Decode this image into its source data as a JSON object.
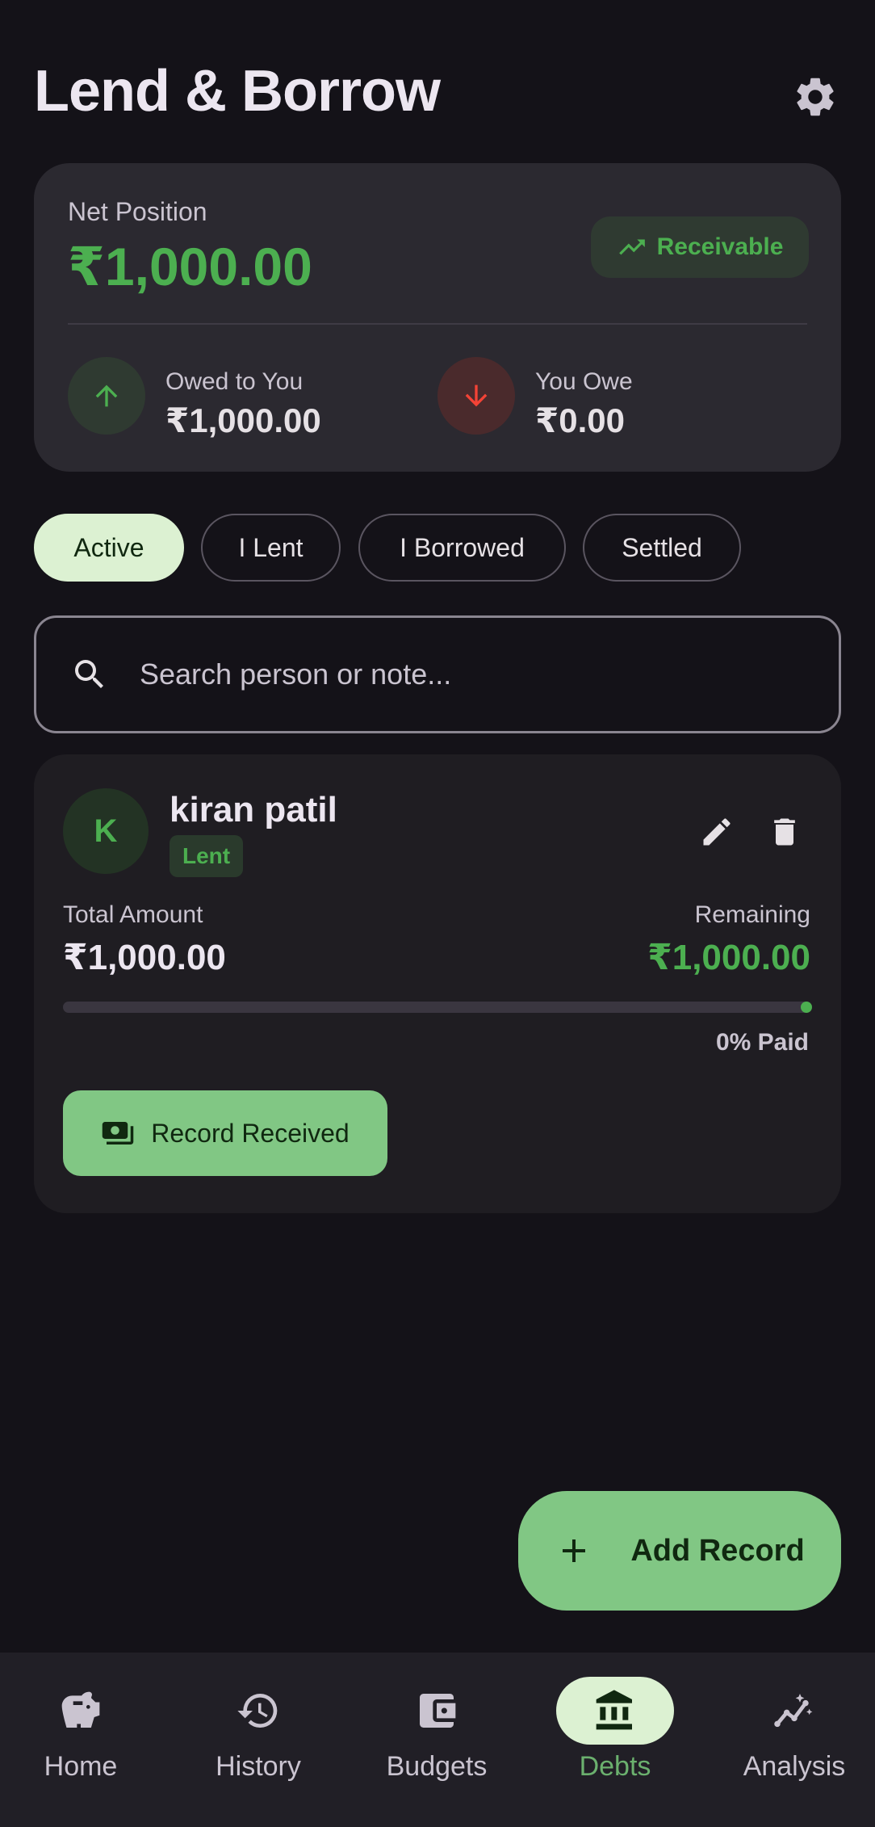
{
  "header": {
    "title": "Lend & Borrow",
    "settings_icon": "gear-icon"
  },
  "summary": {
    "net_label": "Net Position",
    "net_value": "₹1,000.00",
    "badge": "Receivable",
    "owed_to_you_label": "Owed to You",
    "owed_to_you_value": "₹1,000.00",
    "you_owe_label": "You Owe",
    "you_owe_value": "₹0.00"
  },
  "filters": [
    {
      "label": "Active",
      "selected": true
    },
    {
      "label": "I Lent",
      "selected": false
    },
    {
      "label": "I Borrowed",
      "selected": false
    },
    {
      "label": "Settled",
      "selected": false
    }
  ],
  "search": {
    "placeholder": "Search person or note...",
    "value": ""
  },
  "debts": [
    {
      "initial": "K",
      "name": "kiran patil",
      "type": "Lent",
      "total_label": "Total Amount",
      "total_value": "₹1,000.00",
      "remaining_label": "Remaining",
      "remaining_value": "₹1,000.00",
      "paid_fraction": 0,
      "paid_text": "0% Paid",
      "action_label": "Record Received"
    }
  ],
  "fab": {
    "label": "Add Record"
  },
  "nav": [
    {
      "label": "Home",
      "icon": "piggy-bank-icon",
      "active": false
    },
    {
      "label": "History",
      "icon": "history-icon",
      "active": false
    },
    {
      "label": "Budgets",
      "icon": "wallet-icon",
      "active": false
    },
    {
      "label": "Debts",
      "icon": "bank-icon",
      "active": true
    },
    {
      "label": "Analysis",
      "icon": "analytics-icon",
      "active": false
    }
  ],
  "colors": {
    "background": "#141218",
    "accent_green": "#4CAF50",
    "button_green": "#81C784",
    "negative_red": "#F44336"
  }
}
